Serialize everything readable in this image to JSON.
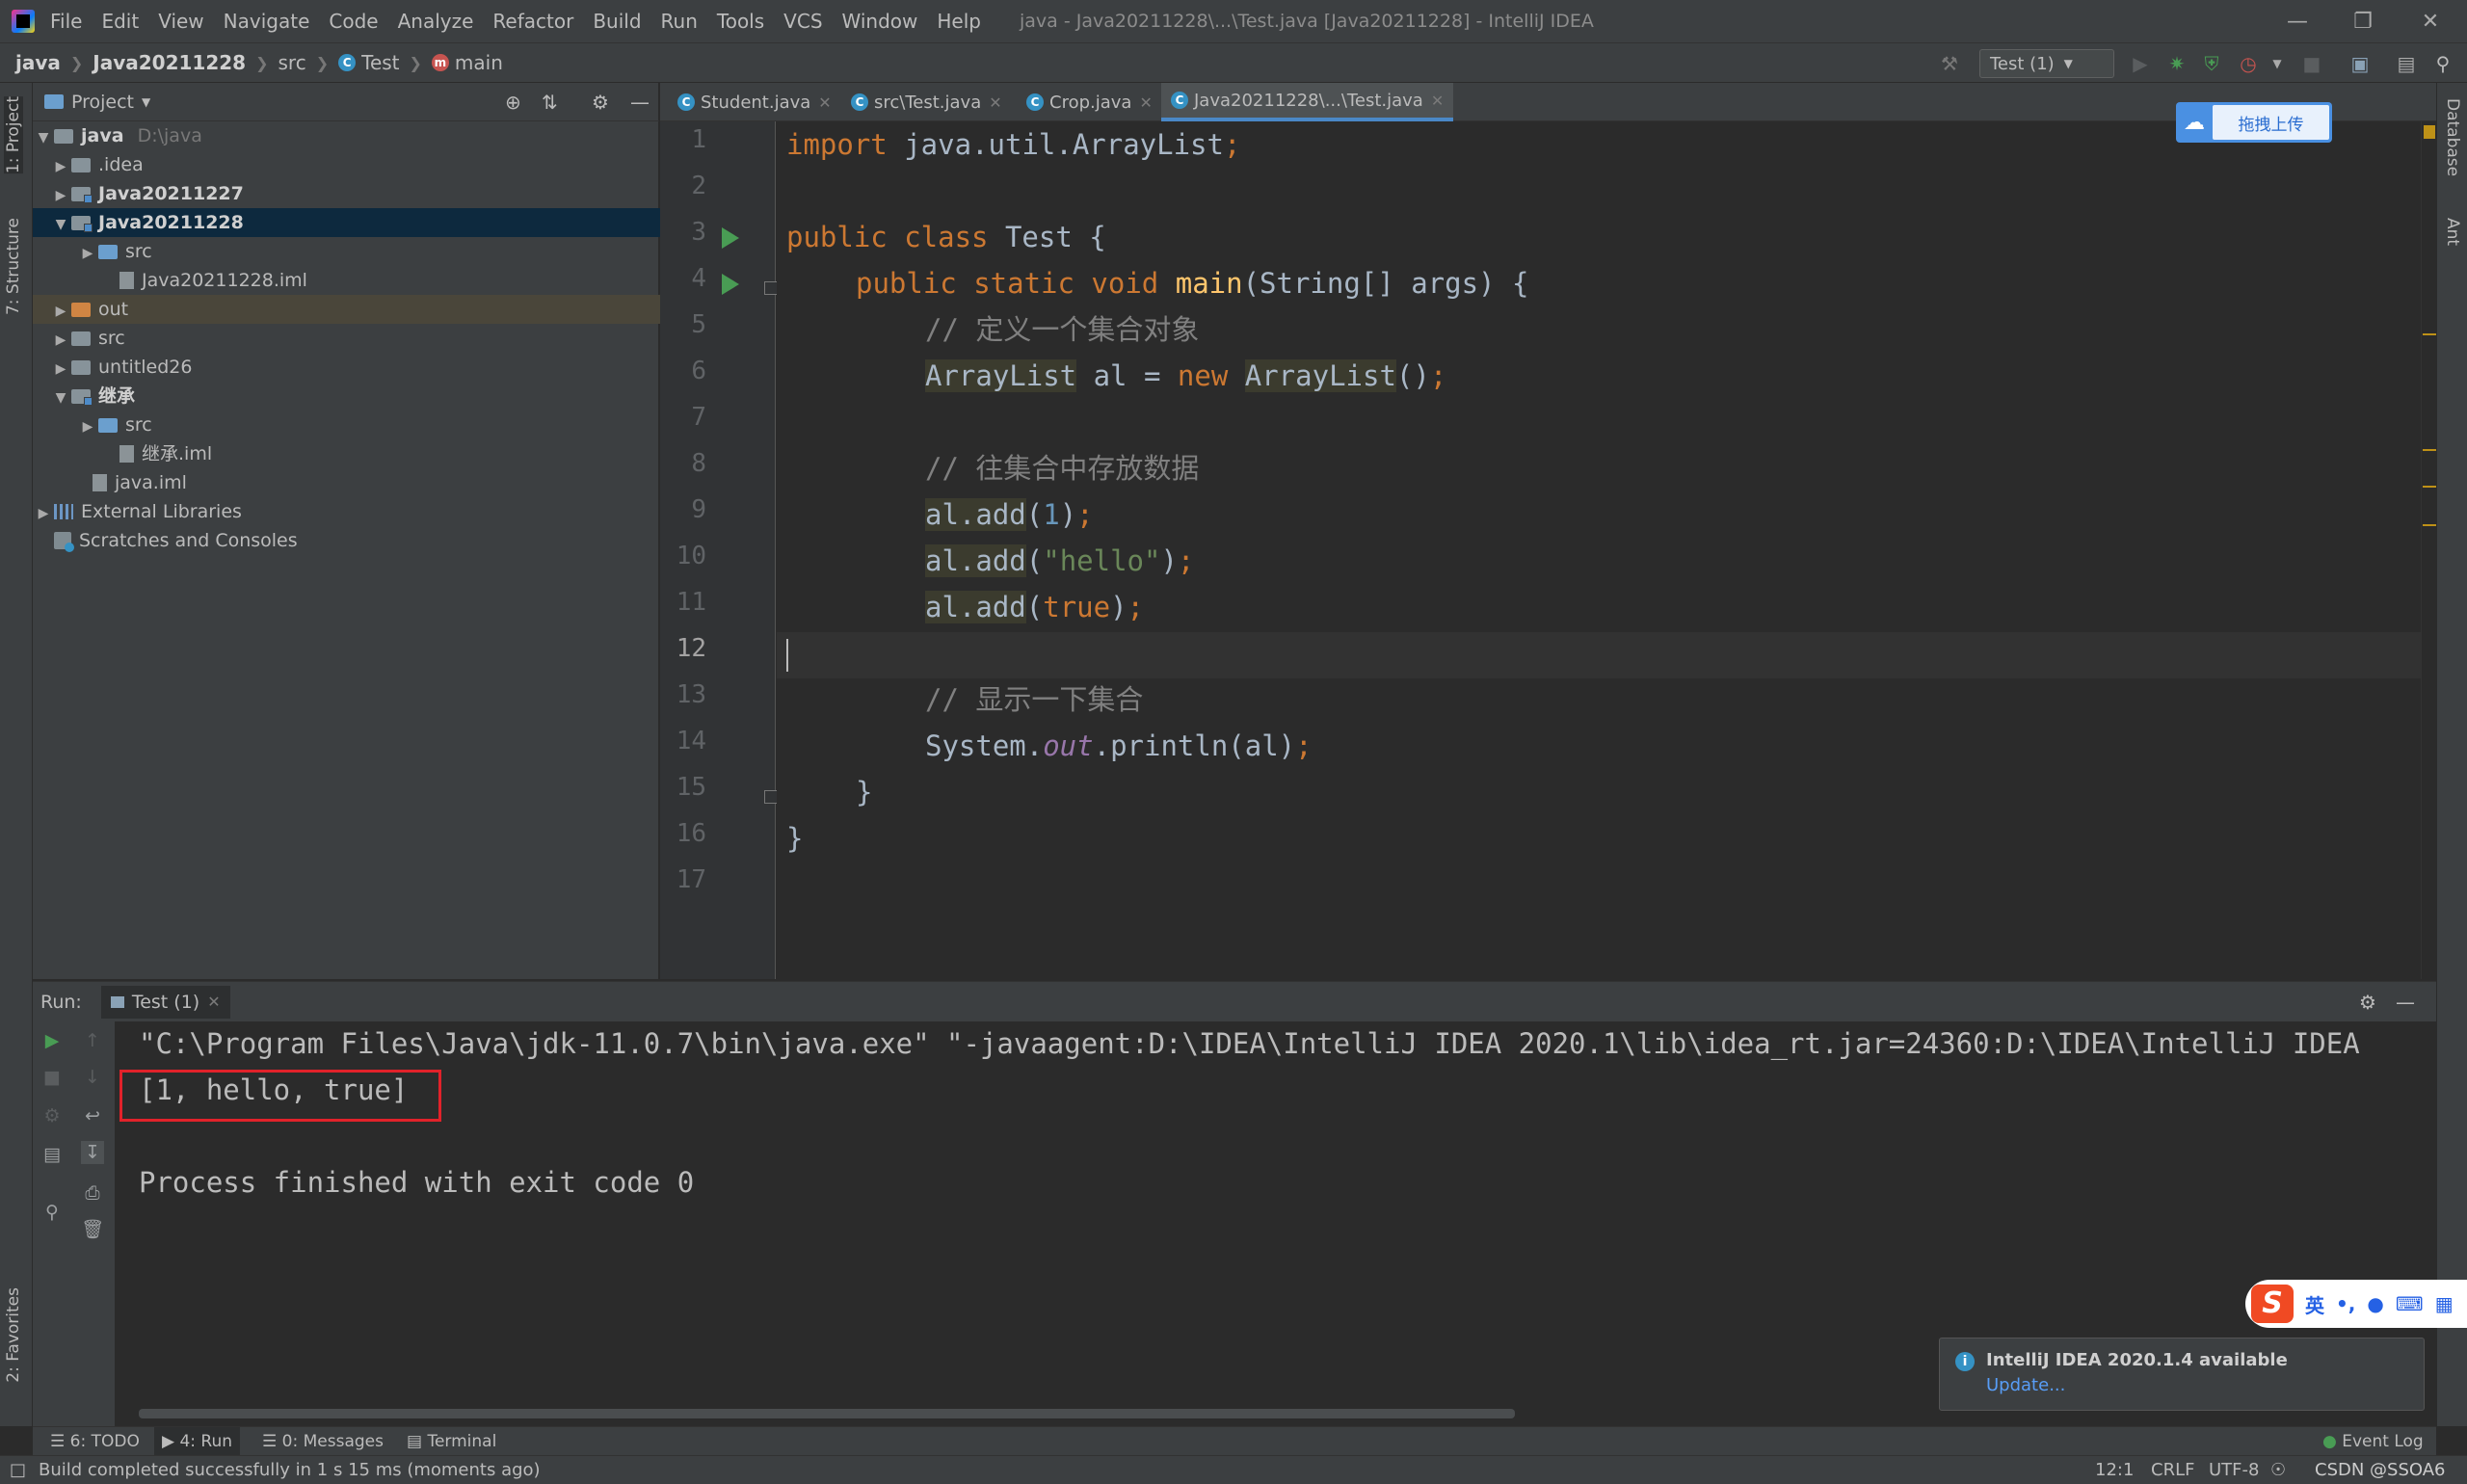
{
  "menubar": {
    "items": [
      "File",
      "Edit",
      "View",
      "Navigate",
      "Code",
      "Analyze",
      "Refactor",
      "Build",
      "Run",
      "Tools",
      "VCS",
      "Window",
      "Help"
    ],
    "window_title": "java - Java20211228\\...\\Test.java [Java20211228] - IntelliJ IDEA"
  },
  "navbar": {
    "crumbs": [
      "java",
      "Java20211228",
      "src",
      "Test",
      "main"
    ],
    "run_config": "Test (1)"
  },
  "left_stripe": {
    "project": "1: Project",
    "structure": "7: Structure",
    "favorites": "2: Favorites"
  },
  "right_stripe": {
    "database": "Database",
    "ant": "Ant"
  },
  "project_panel": {
    "title": "Project",
    "tree": [
      {
        "label": "java",
        "extra": "D:\\java"
      },
      {
        "label": ".idea"
      },
      {
        "label": "Java20211227"
      },
      {
        "label": "Java20211228"
      },
      {
        "label": "src"
      },
      {
        "label": "Java20211228.iml"
      },
      {
        "label": "out"
      },
      {
        "label": "src"
      },
      {
        "label": "untitled26"
      },
      {
        "label": "继承"
      },
      {
        "label": "src"
      },
      {
        "label": "继承.iml"
      },
      {
        "label": "java.iml"
      },
      {
        "label": "External Libraries"
      },
      {
        "label": "Scratches and Consoles"
      }
    ]
  },
  "editor_tabs": [
    {
      "label": "Student.java"
    },
    {
      "label": "src\\Test.java"
    },
    {
      "label": "Crop.java"
    },
    {
      "label": "Java20211228\\...\\Test.java"
    }
  ],
  "cloud_widget": {
    "label": "拖拽上传"
  },
  "editor": {
    "line_numbers": [
      "1",
      "2",
      "3",
      "4",
      "5",
      "6",
      "7",
      "8",
      "9",
      "10",
      "11",
      "12",
      "13",
      "14",
      "15",
      "16",
      "17"
    ],
    "current_line": "12",
    "code": {
      "l1_kw": "import",
      "l1_rest": " java.util.ArrayList",
      "semi": ";",
      "l3_kw": "public class",
      "l3_rest": " Test {",
      "l4_kw": "public static void",
      "l4_fn": "main",
      "l4_rest": "(String[] args) {",
      "l5_cm": "// 定义一个集合对象",
      "l6_type": "ArrayList",
      "l6_mid": " al = ",
      "l6_new": "new",
      "l6_rest": "()",
      "l8_cm": "// 往集合中存放数据",
      "al_add": "al.add",
      "open": "(",
      "close": ")",
      "l9_num": "1",
      "l10_str": "\"hello\"",
      "l11_kw": "true",
      "l13_cm": "// 显示一下集合",
      "l14_a": "System.",
      "l14_out": "out",
      "l14_b": ".println(al)",
      "l15": "}",
      "l16": "}"
    }
  },
  "run_panel": {
    "label": "Run:",
    "tab": "Test (1)",
    "console": [
      "\"C:\\Program Files\\Java\\jdk-11.0.7\\bin\\java.exe\" \"-javaagent:D:\\IDEA\\IntelliJ IDEA 2020.1\\lib\\idea_rt.jar=24360:D:\\IDEA\\IntelliJ IDEA",
      "[1, hello, true]",
      "",
      "Process finished with exit code 0"
    ]
  },
  "notification": {
    "title": "IntelliJ IDEA 2020.1.4 available",
    "link": "Update..."
  },
  "ime": {
    "logo": "S",
    "lang": "英",
    "punct": "•,",
    "mic": "🎤",
    "keyboard": "⌨",
    "grid": "▦"
  },
  "tool_tabs": {
    "todo": "6: TODO",
    "run": "4: Run",
    "messages": "0: Messages",
    "terminal": "Terminal",
    "event_log": "Event Log"
  },
  "status_bar": {
    "message": "Build completed successfully in 1 s 15 ms (moments ago)",
    "position": "12:1",
    "line_sep": "CRLF",
    "encoding": "UTF-8",
    "watermark": "CSDN @SSOA6"
  },
  "colors": {
    "accent": "#4a88c7",
    "run_green": "#499c54",
    "highlight_box": "#e1222a"
  }
}
